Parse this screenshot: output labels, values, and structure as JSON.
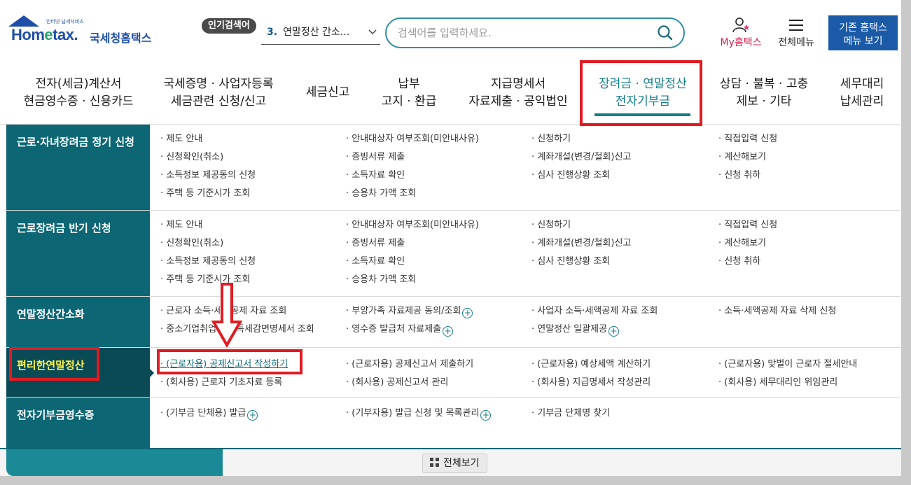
{
  "logo": {
    "sub_text": "인터넷 납세서비스",
    "brand": "Hometax.",
    "brand_korean": "국세청홈택스"
  },
  "popular": {
    "badge": "인기검색어",
    "rank": "3.",
    "item": "연말정산 간소..."
  },
  "search": {
    "placeholder": "검색어를 입력하세요."
  },
  "header": {
    "my_label": "My홈택스",
    "all_menu_label": "전체메뉴",
    "legacy_button": "기존 홈택스\n메뉴 보기"
  },
  "nav": [
    {
      "label": "전자(세금)계산서\n현금영수증 · 신용카드"
    },
    {
      "label": "국세증명 · 사업자등록\n세금관련 신청/신고"
    },
    {
      "label": "세금신고"
    },
    {
      "label": "납부\n고지 · 환급"
    },
    {
      "label": "지급명세서\n자료제출 · 공익법인"
    },
    {
      "label": "장려금 · 연말정산\n전자기부금",
      "active": true
    },
    {
      "label": "상담 · 불복 · 고충\n제보 · 기타"
    },
    {
      "label": "세무대리\n납세관리"
    }
  ],
  "menu": [
    {
      "category": "근로·자녀장려금 정기 신청",
      "links": [
        [
          "· 제도 안내",
          "· 신청확인(취소)",
          "· 소득정보 제공동의 신청",
          "· 주택 등 기준시가 조회"
        ],
        [
          "· 안내대상자 여부조회(미안내사유)",
          "· 증빙서류 제출",
          "· 소득자료 확인",
          "· 승용차 가액 조회"
        ],
        [
          "· 신청하기",
          "· 계좌개설(변경/철회)신고",
          "· 심사 진행상황 조회"
        ],
        [
          "· 직접입력 신청",
          "· 계산해보기",
          "· 신청 취하"
        ]
      ]
    },
    {
      "category": "근로장려금 반기 신청",
      "links": [
        [
          "· 제도 안내",
          "· 신청확인(취소)",
          "· 소득정보 제공동의 신청",
          "· 주택 등 기준시가 조회"
        ],
        [
          "· 안내대상자 여부조회(미안내사유)",
          "· 증빙서류 제출",
          "· 소득자료 확인",
          "· 승용차 가액 조회"
        ],
        [
          "· 신청하기",
          "· 계좌개설(변경/철회)신고",
          "· 심사 진행상황 조회"
        ],
        [
          "· 직접입력 신청",
          "· 계산해보기",
          "· 신청 취하"
        ]
      ]
    },
    {
      "category": "연말정산간소화",
      "links": [
        [
          "· 근로자 소득·세액공제 자료 조회",
          "· 중소기업취업자 소득세감면명세서 조회"
        ],
        [
          "· 부양가족 자료제공 동의/조회",
          "· 영수증 발급처 자료제출"
        ],
        [
          "· 사업자 소득·세액공제 자료 조회",
          "· 연말정산 일괄제공"
        ],
        [
          "· 소득·세액공제 자료 삭제 신청"
        ]
      ]
    },
    {
      "category": "편리한연말정산",
      "links": [
        [
          "· (근로자용) 공제신고서 작성하기",
          "· (회사용) 근로자 기초자료 등록"
        ],
        [
          "· (근로자용) 공제신고서 제출하기",
          "· (회사용) 공제신고서 관리"
        ],
        [
          "· (근로자용) 예상세액 계산하기",
          "· (회사용) 지급명세서 작성관리"
        ],
        [
          "· (근로자용) 맞벌이 근로자 절세안내",
          "· (회사용) 세무대리인 위임관리"
        ]
      ]
    },
    {
      "category": "전자기부금영수증",
      "links": [
        [
          "· (기부금 단체용) 발급"
        ],
        [
          "· (기부자용) 발급 신청 및 목록관리"
        ],
        [
          "· 기부금 단체명 찾기"
        ],
        []
      ]
    }
  ],
  "footer": {
    "view_all": "전체보기"
  },
  "colors": {
    "teal": "#0c6674",
    "brand_blue": "#1e4fa8",
    "annotation_red": "#e11b22",
    "highlight_yellow": "#fff24a"
  }
}
